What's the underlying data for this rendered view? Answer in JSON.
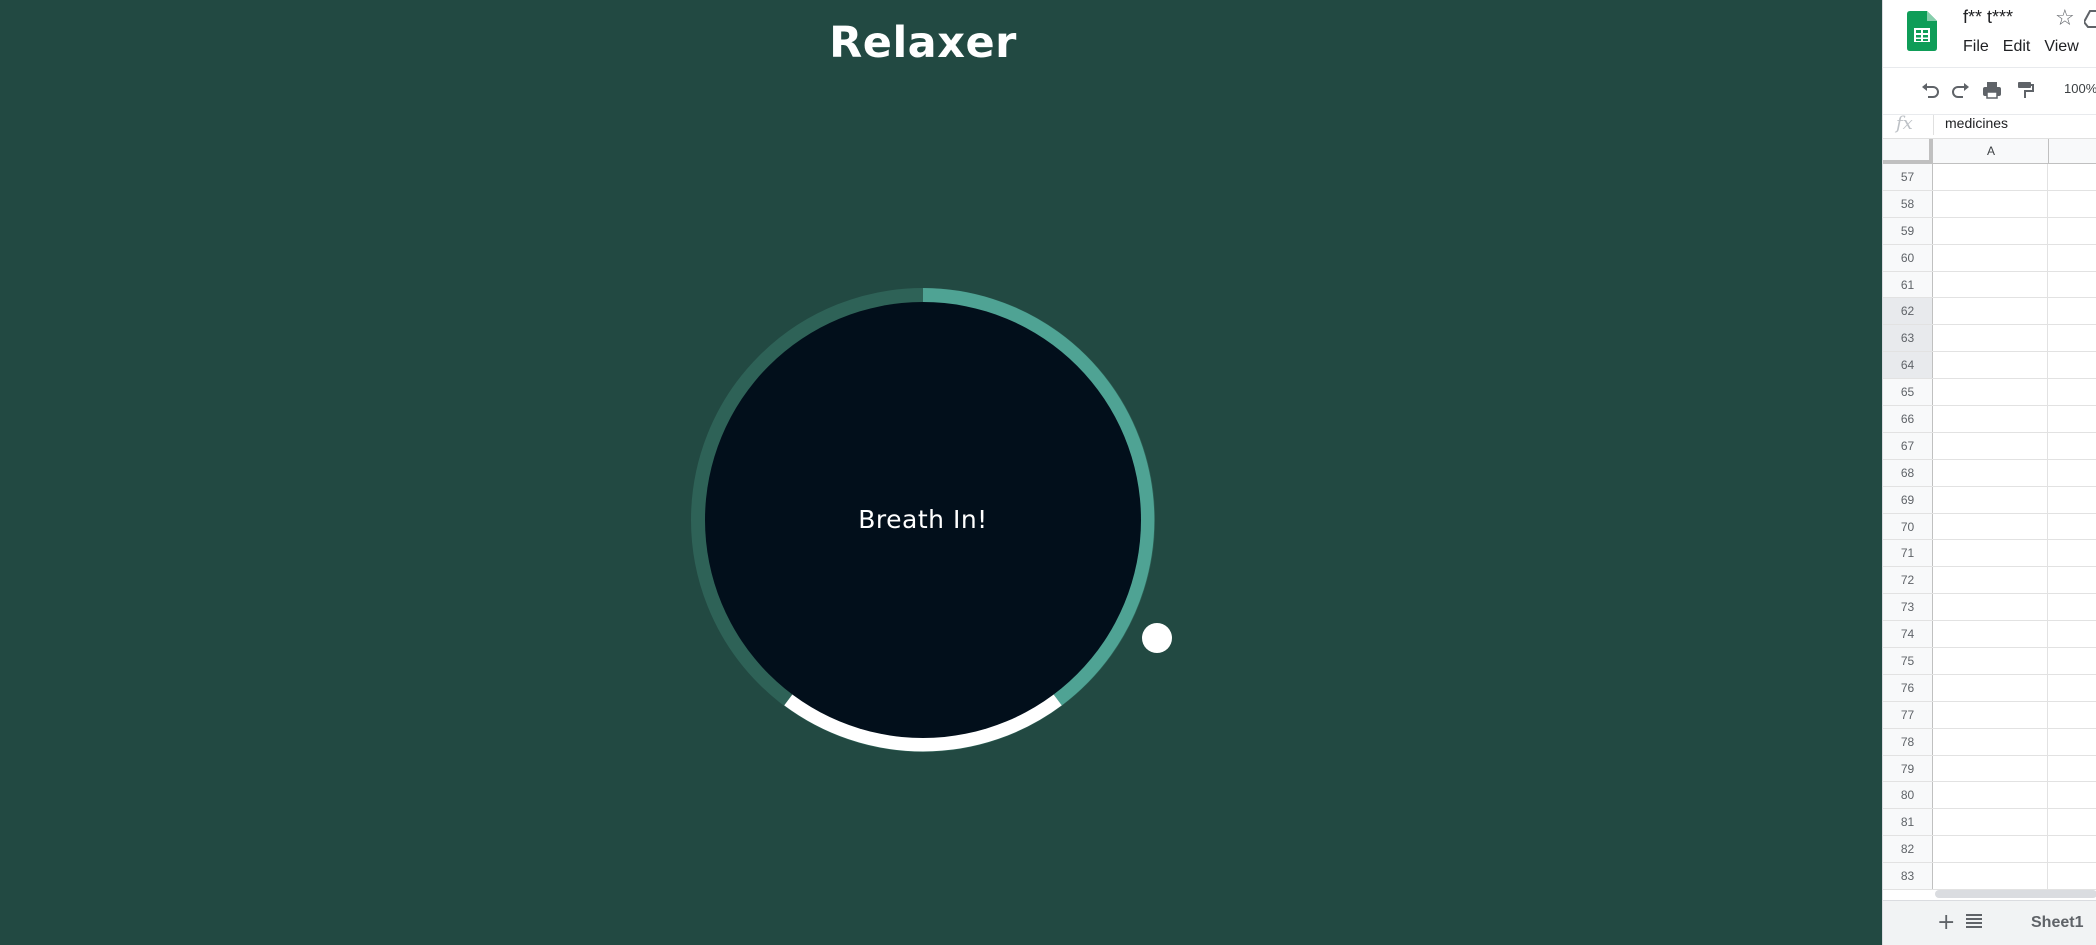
{
  "relaxer": {
    "title": "Relaxer",
    "instruction": "Breath In!"
  },
  "sheets": {
    "doc_title": "f** t***",
    "menu": [
      "File",
      "Edit",
      "View"
    ],
    "zoom": "100%",
    "formula_icon": "fx",
    "formula_value": "medicines",
    "column_a": "A",
    "rows": [
      "57",
      "58",
      "59",
      "60",
      "61",
      "62",
      "63",
      "64",
      "65",
      "66",
      "67",
      "68",
      "69",
      "70",
      "71",
      "72",
      "73",
      "74",
      "75",
      "76",
      "77",
      "78",
      "79",
      "80",
      "81",
      "82",
      "83"
    ],
    "selected_rows": [
      "62",
      "63",
      "64"
    ],
    "add_sheet": "+",
    "sheet_tab": "Sheet1"
  },
  "colors": {
    "background": "#224942",
    "circle_fill": "#020f1b",
    "ring_track": "#2e6257",
    "ring_accent": "#4fa394",
    "ring_white": "#ffffff"
  }
}
